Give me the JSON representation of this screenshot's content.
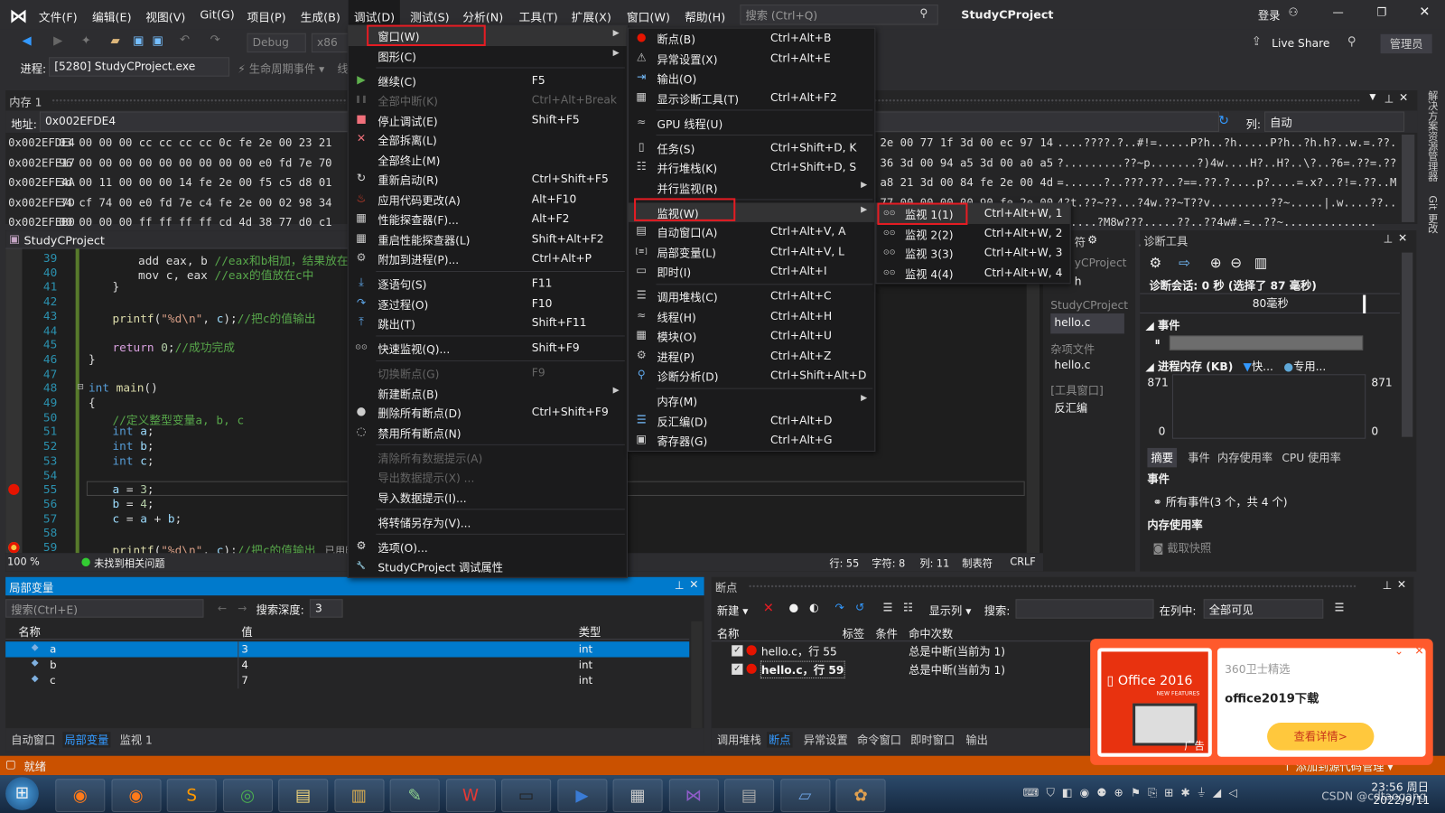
{
  "app": {
    "title": "StudyCProject",
    "search_placeholder": "搜索 (Ctrl+Q)",
    "login": "登录",
    "live_share": "Live Share",
    "admin": "管理员"
  },
  "menubar": [
    "文件(F)",
    "编辑(E)",
    "视图(V)",
    "Git(G)",
    "项目(P)",
    "生成(B)",
    "调试(D)",
    "测试(S)",
    "分析(N)",
    "工具(T)",
    "扩展(X)",
    "窗口(W)",
    "帮助(H)"
  ],
  "toolbar": {
    "config": "Debug",
    "platform": "x86",
    "process_label": "进程:",
    "process": "[5280] StudyCProject.exe",
    "lifecycle": "生命周期事件",
    "thread_cut": "线"
  },
  "memory": {
    "title": "内存 1",
    "address_label": "地址:",
    "address": "0x002EFDE4",
    "columns_label": "列:",
    "columns": "自动",
    "rows": [
      {
        "addr": "0x002EFDE4",
        "hex": "03 00 00 00 cc cc cc cc 0c fe 2e 00 23 21",
        "hex2": "2e 00 77 1f 3d 00 ec 97 14",
        "ascii": "....????.?..#!=.....P?h..?h.....P?h..?h.h?..w.=.??."
      },
      {
        "addr": "0x002EFE17",
        "hex": "96 00 00 00 00 00 00 00 00 00 e0 fd 7e 70",
        "hex2": "36 3d 00 94 a5 3d 00 a0 a5",
        "ascii": "?.........??~p.......?)4w....H?..H?..\\?..?6=.??=.??"
      },
      {
        "addr": "0x002EFE4A",
        "hex": "3d 00 11 00 00 00 14 fe 2e 00 f5 c5 d8 01",
        "hex2": "a8 21 3d 00 84 fe 2e 00 4d",
        "ascii": "=......?..???.??..?==.??.?....p?....=.x?..?!=.??..M"
      },
      {
        "addr": "0x002EFE7D",
        "hex": "34 cf 74 00 e0 fd 7e c4 fe 2e 00 02 98 34",
        "hex2": "77 00 00 00 00 90 fe 2e 00",
        "ascii": "4?t.??~??...?4w.??~T??v.........??~.....|.w....??.."
      },
      {
        "addr": "0x002EFEB0",
        "hex": "00 00 00 00 ff ff ff ff cd 4d 38 77 d0 c1",
        "hex2": "",
        "ascii": "......?M8w???.....??..??4w#.=..??~.............."
      },
      {
        "addr": "0x002EFEE3",
        "hex": "00 23 10 3d 00 00 e0 fd 7e 00 00 00 00 00",
        "hex2": "",
        "ascii": "=..??~........................................"
      }
    ]
  },
  "editor": {
    "tab": "StudyCProject",
    "zoom": "100 %",
    "issues": "未找到相关问题",
    "line": "行: 55",
    "char": "字符: 8",
    "col": "列: 11",
    "tabs": "制表符",
    "eol": "CRLF",
    "elapsed": "已用时",
    "lines": [
      {
        "n": "39",
        "i": 3,
        "t": [
          [
            "add eax, b  ",
            "pl"
          ],
          [
            "//eax和b相加，结果放在c中",
            "cm"
          ]
        ]
      },
      {
        "n": "40",
        "i": 3,
        "t": [
          [
            "mov c, eax  ",
            "pl"
          ],
          [
            "//eax的值放在c中",
            "cm"
          ]
        ]
      },
      {
        "n": "41",
        "i": 2,
        "t": [
          [
            "}",
            "pl"
          ]
        ]
      },
      {
        "n": "42",
        "i": 2,
        "t": []
      },
      {
        "n": "43",
        "i": 2,
        "t": [
          [
            "printf",
            "fn"
          ],
          [
            "(",
            "pl"
          ],
          [
            "\"%d\\n\"",
            "st"
          ],
          [
            ", ",
            "pl"
          ],
          [
            "c",
            "vr"
          ],
          [
            ");",
            "pl"
          ],
          [
            "//把c的值输出",
            "cm"
          ]
        ]
      },
      {
        "n": "44",
        "i": 2,
        "t": []
      },
      {
        "n": "45",
        "i": 2,
        "t": [
          [
            "return ",
            "rt"
          ],
          [
            "0",
            "nu"
          ],
          [
            ";",
            "pl"
          ],
          [
            "//成功完成",
            "cm"
          ]
        ]
      },
      {
        "n": "46",
        "i": 1,
        "t": [
          [
            "}",
            "pl"
          ]
        ]
      },
      {
        "n": "47",
        "i": 1,
        "t": []
      },
      {
        "n": "48",
        "i": 1,
        "t": [
          [
            "int ",
            "kw"
          ],
          [
            "main",
            "fn"
          ],
          [
            "()",
            "pl"
          ]
        ]
      },
      {
        "n": "49",
        "i": 1,
        "t": [
          [
            "{",
            "pl"
          ]
        ]
      },
      {
        "n": "50",
        "i": 2,
        "t": [
          [
            "//定义整型变量a, b, c",
            "cm"
          ]
        ]
      },
      {
        "n": "51",
        "i": 2,
        "t": [
          [
            "int ",
            "kw"
          ],
          [
            "a",
            "vr"
          ],
          [
            ";",
            "pl"
          ]
        ]
      },
      {
        "n": "52",
        "i": 2,
        "t": [
          [
            "int ",
            "kw"
          ],
          [
            "b",
            "vr"
          ],
          [
            ";",
            "pl"
          ]
        ]
      },
      {
        "n": "53",
        "i": 2,
        "t": [
          [
            "int ",
            "kw"
          ],
          [
            "c",
            "vr"
          ],
          [
            ";",
            "pl"
          ]
        ]
      },
      {
        "n": "54",
        "i": 2,
        "t": []
      },
      {
        "n": "55",
        "i": 2,
        "t": [
          [
            "a",
            "vr"
          ],
          [
            " = ",
            "pl"
          ],
          [
            "3",
            "nu"
          ],
          [
            ";",
            "pl"
          ]
        ]
      },
      {
        "n": "56",
        "i": 2,
        "t": [
          [
            "b",
            "vr"
          ],
          [
            " = ",
            "pl"
          ],
          [
            "4",
            "nu"
          ],
          [
            ";",
            "pl"
          ]
        ]
      },
      {
        "n": "57",
        "i": 2,
        "t": [
          [
            "c",
            "vr"
          ],
          [
            " = ",
            "pl"
          ],
          [
            "a",
            "vr"
          ],
          [
            " + ",
            "pl"
          ],
          [
            "b",
            "vr"
          ],
          [
            ";",
            "pl"
          ]
        ]
      },
      {
        "n": "58",
        "i": 2,
        "t": []
      },
      {
        "n": "59",
        "i": 2,
        "t": [
          [
            "printf",
            "fn"
          ],
          [
            "(",
            "pl"
          ],
          [
            "\"%d\\n\"",
            "st"
          ],
          [
            ", ",
            "pl"
          ],
          [
            "c",
            "vr"
          ],
          [
            ");",
            "pl"
          ],
          [
            "//把c的值输出",
            "cm"
          ]
        ]
      }
    ],
    "current_line": "55",
    "breakpoints": [
      "55",
      "59"
    ]
  },
  "debug_menu": [
    {
      "label": "窗口(W)",
      "arrow": true,
      "hl": true
    },
    {
      "label": "图形(C)",
      "arrow": true
    },
    {
      "sep": true
    },
    {
      "label": "继续(C)",
      "sc": "F5",
      "icon": "play"
    },
    {
      "label": "全部中断(K)",
      "sc": "Ctrl+Alt+Break",
      "icon": "pause",
      "dis": true
    },
    {
      "label": "停止调试(E)",
      "sc": "Shift+F5",
      "icon": "stop"
    },
    {
      "label": "全部拆离(L)",
      "icon": "detach"
    },
    {
      "label": "全部终止(M)"
    },
    {
      "label": "重新启动(R)",
      "sc": "Ctrl+Shift+F5",
      "icon": "restart"
    },
    {
      "label": "应用代码更改(A)",
      "sc": "Alt+F10",
      "icon": "flame"
    },
    {
      "label": "性能探查器(F)...",
      "sc": "Alt+F2",
      "icon": "chart"
    },
    {
      "label": "重启性能探查器(L)",
      "sc": "Shift+Alt+F2",
      "icon": "chart"
    },
    {
      "label": "附加到进程(P)...",
      "sc": "Ctrl+Alt+P",
      "icon": "gears"
    },
    {
      "sep": true
    },
    {
      "label": "逐语句(S)",
      "sc": "F11",
      "icon": "step-into"
    },
    {
      "label": "逐过程(O)",
      "sc": "F10",
      "icon": "step-over"
    },
    {
      "label": "跳出(T)",
      "sc": "Shift+F11",
      "icon": "step-out"
    },
    {
      "sep": true
    },
    {
      "label": "快速监视(Q)...",
      "sc": "Shift+F9",
      "icon": "glasses"
    },
    {
      "sep": true
    },
    {
      "label": "切换断点(G)",
      "sc": "F9",
      "dis": true
    },
    {
      "label": "新建断点(B)",
      "arrow": true
    },
    {
      "label": "删除所有断点(D)",
      "sc": "Ctrl+Shift+F9",
      "icon": "delete-breakpoints"
    },
    {
      "label": "禁用所有断点(N)",
      "icon": "disable-breakpoints"
    },
    {
      "sep": true
    },
    {
      "label": "清除所有数据提示(A)",
      "dis": true
    },
    {
      "label": "导出数据提示(X) ...",
      "dis": true
    },
    {
      "label": "导入数据提示(I)..."
    },
    {
      "sep": true
    },
    {
      "label": "将转储另存为(V)..."
    },
    {
      "sep": true
    },
    {
      "label": "选项(O)...",
      "icon": "gear"
    },
    {
      "label": "StudyCProject 调试属性",
      "icon": "wrench"
    }
  ],
  "window_menu": [
    {
      "label": "断点(B)",
      "sc": "Ctrl+Alt+B",
      "icon": "breakpoint"
    },
    {
      "label": "异常设置(X)",
      "sc": "Ctrl+Alt+E",
      "icon": "exception"
    },
    {
      "label": "输出(O)",
      "icon": "output"
    },
    {
      "label": "显示诊断工具(T)",
      "sc": "Ctrl+Alt+F2",
      "icon": "chart"
    },
    {
      "sep": true
    },
    {
      "label": "GPU 线程(U)",
      "icon": "threads"
    },
    {
      "sep": true
    },
    {
      "label": "任务(S)",
      "sc": "Ctrl+Shift+D, K",
      "icon": "task"
    },
    {
      "label": "并行堆栈(K)",
      "sc": "Ctrl+Shift+D, S",
      "icon": "parallel-stacks"
    },
    {
      "label": "并行监视(R)",
      "arrow": true
    },
    {
      "sep": true
    },
    {
      "label": "监视(W)",
      "arrow": true,
      "hl": true
    },
    {
      "label": "自动窗口(A)",
      "sc": "Ctrl+Alt+V, A",
      "icon": "autos"
    },
    {
      "label": "局部变量(L)",
      "sc": "Ctrl+Alt+V, L",
      "icon": "locals"
    },
    {
      "label": "即时(I)",
      "sc": "Ctrl+Alt+I",
      "icon": "immediate"
    },
    {
      "sep": true
    },
    {
      "label": "调用堆栈(C)",
      "sc": "Ctrl+Alt+C",
      "icon": "call-stack"
    },
    {
      "label": "线程(H)",
      "sc": "Ctrl+Alt+H",
      "icon": "threads"
    },
    {
      "label": "模块(O)",
      "sc": "Ctrl+Alt+U",
      "icon": "modules"
    },
    {
      "label": "进程(P)",
      "sc": "Ctrl+Alt+Z",
      "icon": "gears"
    },
    {
      "label": "诊断分析(D)",
      "sc": "Ctrl+Shift+Alt+D",
      "icon": "diagnose"
    },
    {
      "sep": true
    },
    {
      "label": "内存(M)",
      "arrow": true
    },
    {
      "label": "反汇编(D)",
      "sc": "Ctrl+Alt+D",
      "icon": "disassembly"
    },
    {
      "label": "寄存器(G)",
      "sc": "Ctrl+Alt+G",
      "icon": "registers"
    }
  ],
  "watch_menu": [
    {
      "label": "监视 1(1)",
      "sc": "Ctrl+Alt+W, 1",
      "icon": "glasses",
      "hl": true
    },
    {
      "label": "监视 2(2)",
      "sc": "Ctrl+Alt+W, 2",
      "icon": "glasses"
    },
    {
      "label": "监视 3(3)",
      "sc": "Ctrl+Alt+W, 3",
      "icon": "glasses"
    },
    {
      "label": "监视 4(4)",
      "sc": "Ctrl+Alt+W, 4",
      "icon": "glasses"
    }
  ],
  "solution": {
    "title_cut": "符",
    "project_cut": "yCProject",
    "h_cut": "h",
    "project": "StudyCProject",
    "file": "hello.c",
    "misc": "杂项文件",
    "misc_file": "hello.c",
    "tool_windows": "[工具窗口]",
    "disasm": "反汇编"
  },
  "diagnostics": {
    "title": "诊断工具",
    "session": "诊断会话: 0 秒 (选择了 87 毫秒)",
    "timeline": "80毫秒",
    "events": "事件",
    "memory": "进程内存 (KB)",
    "legend_fast": "快...",
    "legend_private": "专用...",
    "ymax": "871",
    "ymin": "0",
    "tabs": [
      "摘要",
      "事件",
      "内存使用率",
      "CPU 使用率"
    ],
    "events_header": "事件",
    "all_events": "所有事件(3 个，共 4 个)",
    "mem_header": "内存使用率",
    "snapshot": "截取快照"
  },
  "locals": {
    "title": "局部变量",
    "search_placeholder": "搜索(Ctrl+E)",
    "depth_label": "搜索深度:",
    "depth": "3",
    "columns": [
      "名称",
      "值",
      "类型"
    ],
    "rows": [
      {
        "name": "a",
        "value": "3",
        "type": "int"
      },
      {
        "name": "b",
        "value": "4",
        "type": "int"
      },
      {
        "name": "c",
        "value": "7",
        "type": "int"
      }
    ],
    "tabs": [
      "自动窗口",
      "局部变量",
      "监视 1"
    ],
    "active_tab": 1
  },
  "breakpoints": {
    "title": "断点",
    "new": "新建",
    "show_columns": "显示列",
    "search_label": "搜索:",
    "in_column_label": "在列中:",
    "in_column": "全部可见",
    "columns": [
      "名称",
      "标签",
      "条件",
      "命中次数"
    ],
    "rows": [
      {
        "name": "hello.c，行 55",
        "hits": "总是中断(当前为 1)",
        "checked": true
      },
      {
        "name": "hello.c，行 59",
        "hits": "总是中断(当前为 1)",
        "checked": true
      }
    ],
    "tabs": [
      "调用堆栈",
      "断点",
      "异常设置",
      "命令窗口",
      "即时窗口",
      "输出"
    ],
    "active_tab": 1
  },
  "status": {
    "text": "就绪",
    "source_control": "↑ 添加到源代码管理 ▾"
  },
  "side_tabs": [
    "解决方案资源管理器",
    "Git 更改"
  ],
  "ad": {
    "source": "360卫士精选",
    "title": "office2019下载",
    "button": "查看详情>",
    "tag": "广告",
    "logo_text": "Office 2016",
    "logo_sub": "NEW FEATURES"
  },
  "taskbar": {
    "apps": [
      "firefox",
      "firefox",
      "sublime",
      "chrome",
      "explorer",
      "folder",
      "notepad",
      "wps",
      "cmd",
      "media-player",
      "calculator",
      "visual-studio",
      "reader",
      "window",
      "paint"
    ],
    "time": "23:56 周日",
    "date": "2022/9/11",
    "watermark": "CSDN @cdtaogang"
  },
  "colors": {
    "accent": "#007acc",
    "status_bar": "#ca5100",
    "highlight_box": "#e51c23",
    "selection": "#007acc"
  }
}
